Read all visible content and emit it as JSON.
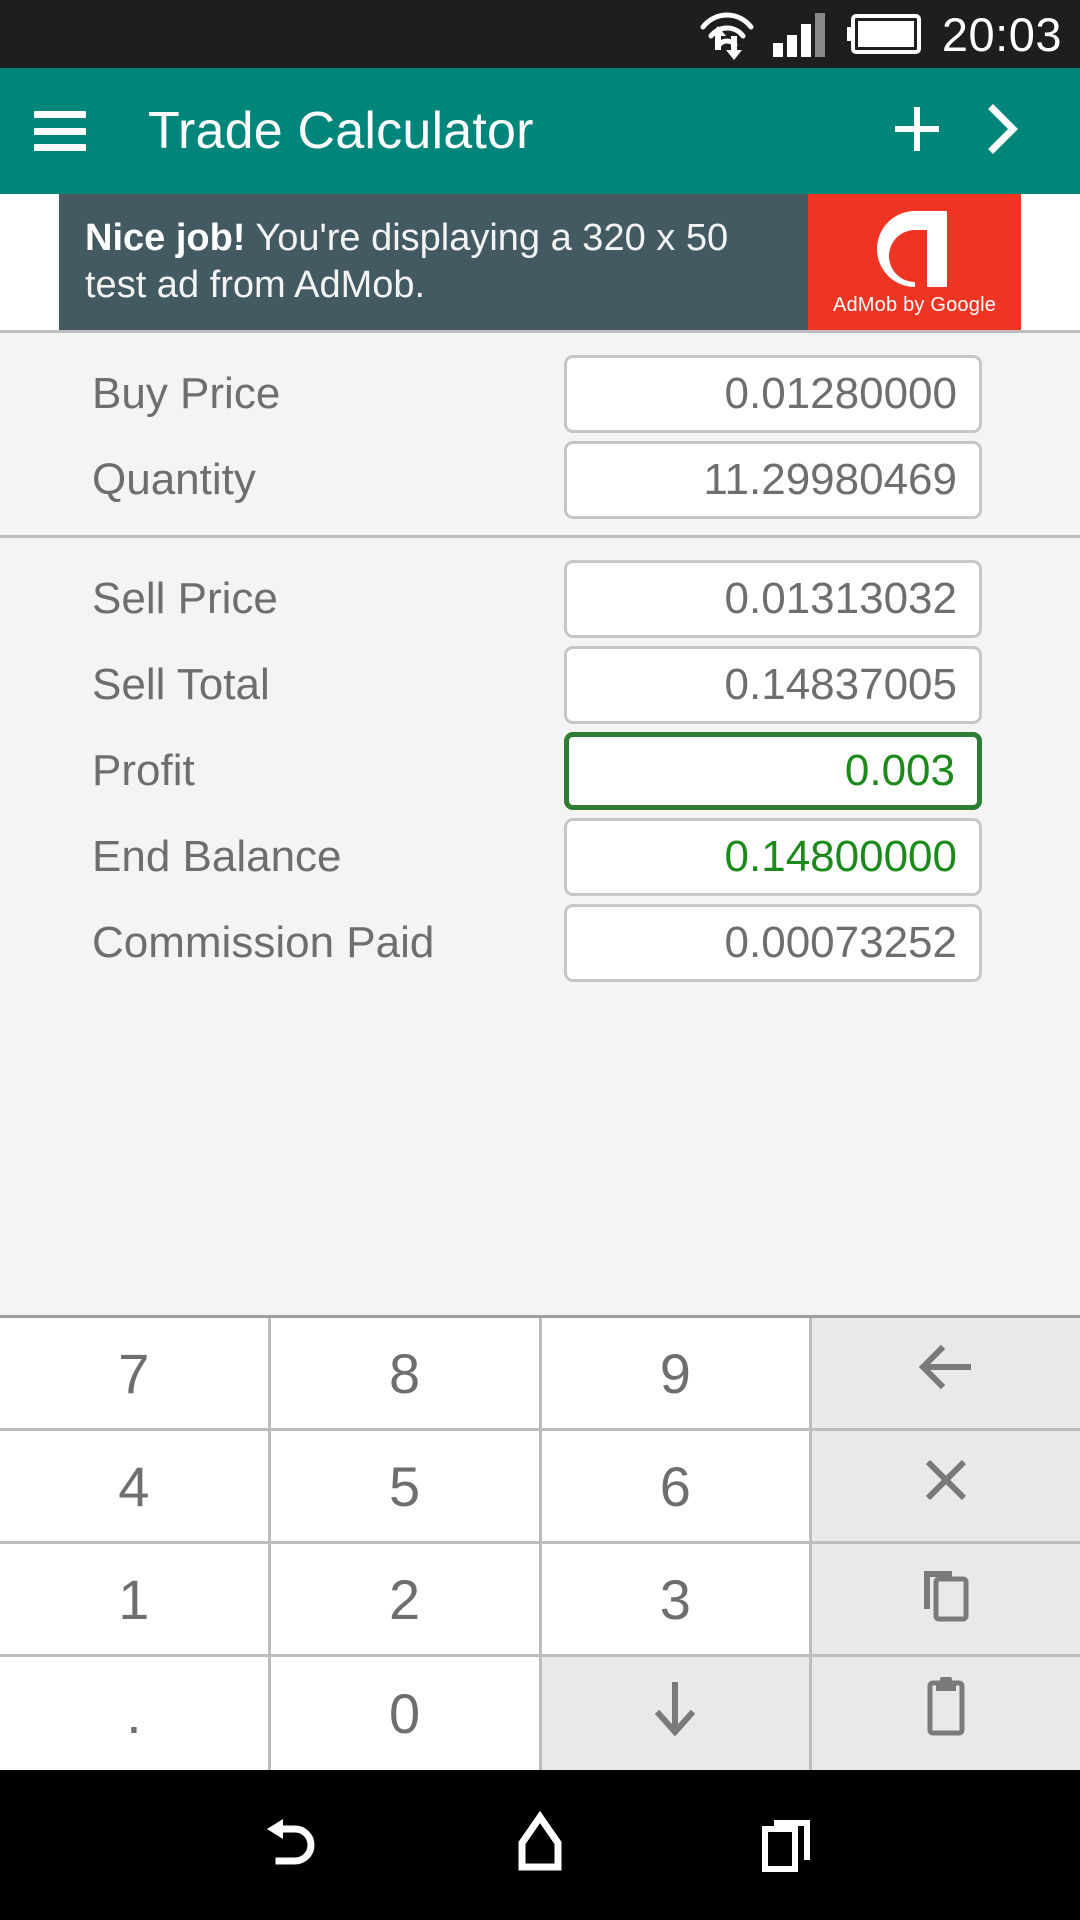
{
  "statusbar": {
    "clock": "20:03",
    "icons": [
      "wifi-transfer-icon",
      "cellular-signal-icon",
      "battery-icon"
    ]
  },
  "appbar": {
    "title": "Trade Calculator",
    "menu_icon": "hamburger-menu-icon",
    "add_icon": "plus-icon",
    "next_icon": "chevron-right-icon",
    "background": "#00857a"
  },
  "ad": {
    "headline": "Nice job!",
    "body": " You're displaying a 320 x 50 test ad from AdMob.",
    "logo_caption": "AdMob by Google",
    "logo_color": "#ee3524",
    "background": "#445a62"
  },
  "form": {
    "buy_group": [
      {
        "label": "Buy Price",
        "value": "0.01280000",
        "state": "normal"
      },
      {
        "label": "Quantity",
        "value": "11.29980469",
        "state": "normal"
      }
    ],
    "sell_group": [
      {
        "label": "Sell Price",
        "value": "0.01313032",
        "state": "normal"
      },
      {
        "label": "Sell Total",
        "value": "0.14837005",
        "state": "normal"
      },
      {
        "label": "Profit",
        "value": "0.003",
        "state": "focused-green"
      },
      {
        "label": "End Balance",
        "value": "0.14800000",
        "state": "green"
      },
      {
        "label": "Commission Paid",
        "value": "0.00073252",
        "state": "normal"
      }
    ],
    "accent_green": "#1b8a1b",
    "focus_border": "#2e7d32"
  },
  "keypad": {
    "rows": [
      [
        {
          "label": "7",
          "name": "key-7",
          "type": "digit"
        },
        {
          "label": "8",
          "name": "key-8",
          "type": "digit"
        },
        {
          "label": "9",
          "name": "key-9",
          "type": "digit"
        },
        {
          "label": "",
          "name": "backspace-icon",
          "type": "fn"
        }
      ],
      [
        {
          "label": "4",
          "name": "key-4",
          "type": "digit"
        },
        {
          "label": "5",
          "name": "key-5",
          "type": "digit"
        },
        {
          "label": "6",
          "name": "key-6",
          "type": "digit"
        },
        {
          "label": "",
          "name": "clear-icon",
          "type": "fn"
        }
      ],
      [
        {
          "label": "1",
          "name": "key-1",
          "type": "digit"
        },
        {
          "label": "2",
          "name": "key-2",
          "type": "digit"
        },
        {
          "label": "3",
          "name": "key-3",
          "type": "digit"
        },
        {
          "label": "",
          "name": "copy-icon",
          "type": "fn"
        }
      ],
      [
        {
          "label": ".",
          "name": "key-decimal",
          "type": "digit"
        },
        {
          "label": "0",
          "name": "key-0",
          "type": "digit"
        },
        {
          "label": "",
          "name": "next-field-icon",
          "type": "fn"
        },
        {
          "label": "",
          "name": "paste-icon",
          "type": "fn"
        }
      ]
    ]
  },
  "navbar": {
    "back": "back-icon",
    "home": "home-icon",
    "recents": "recents-icon"
  }
}
